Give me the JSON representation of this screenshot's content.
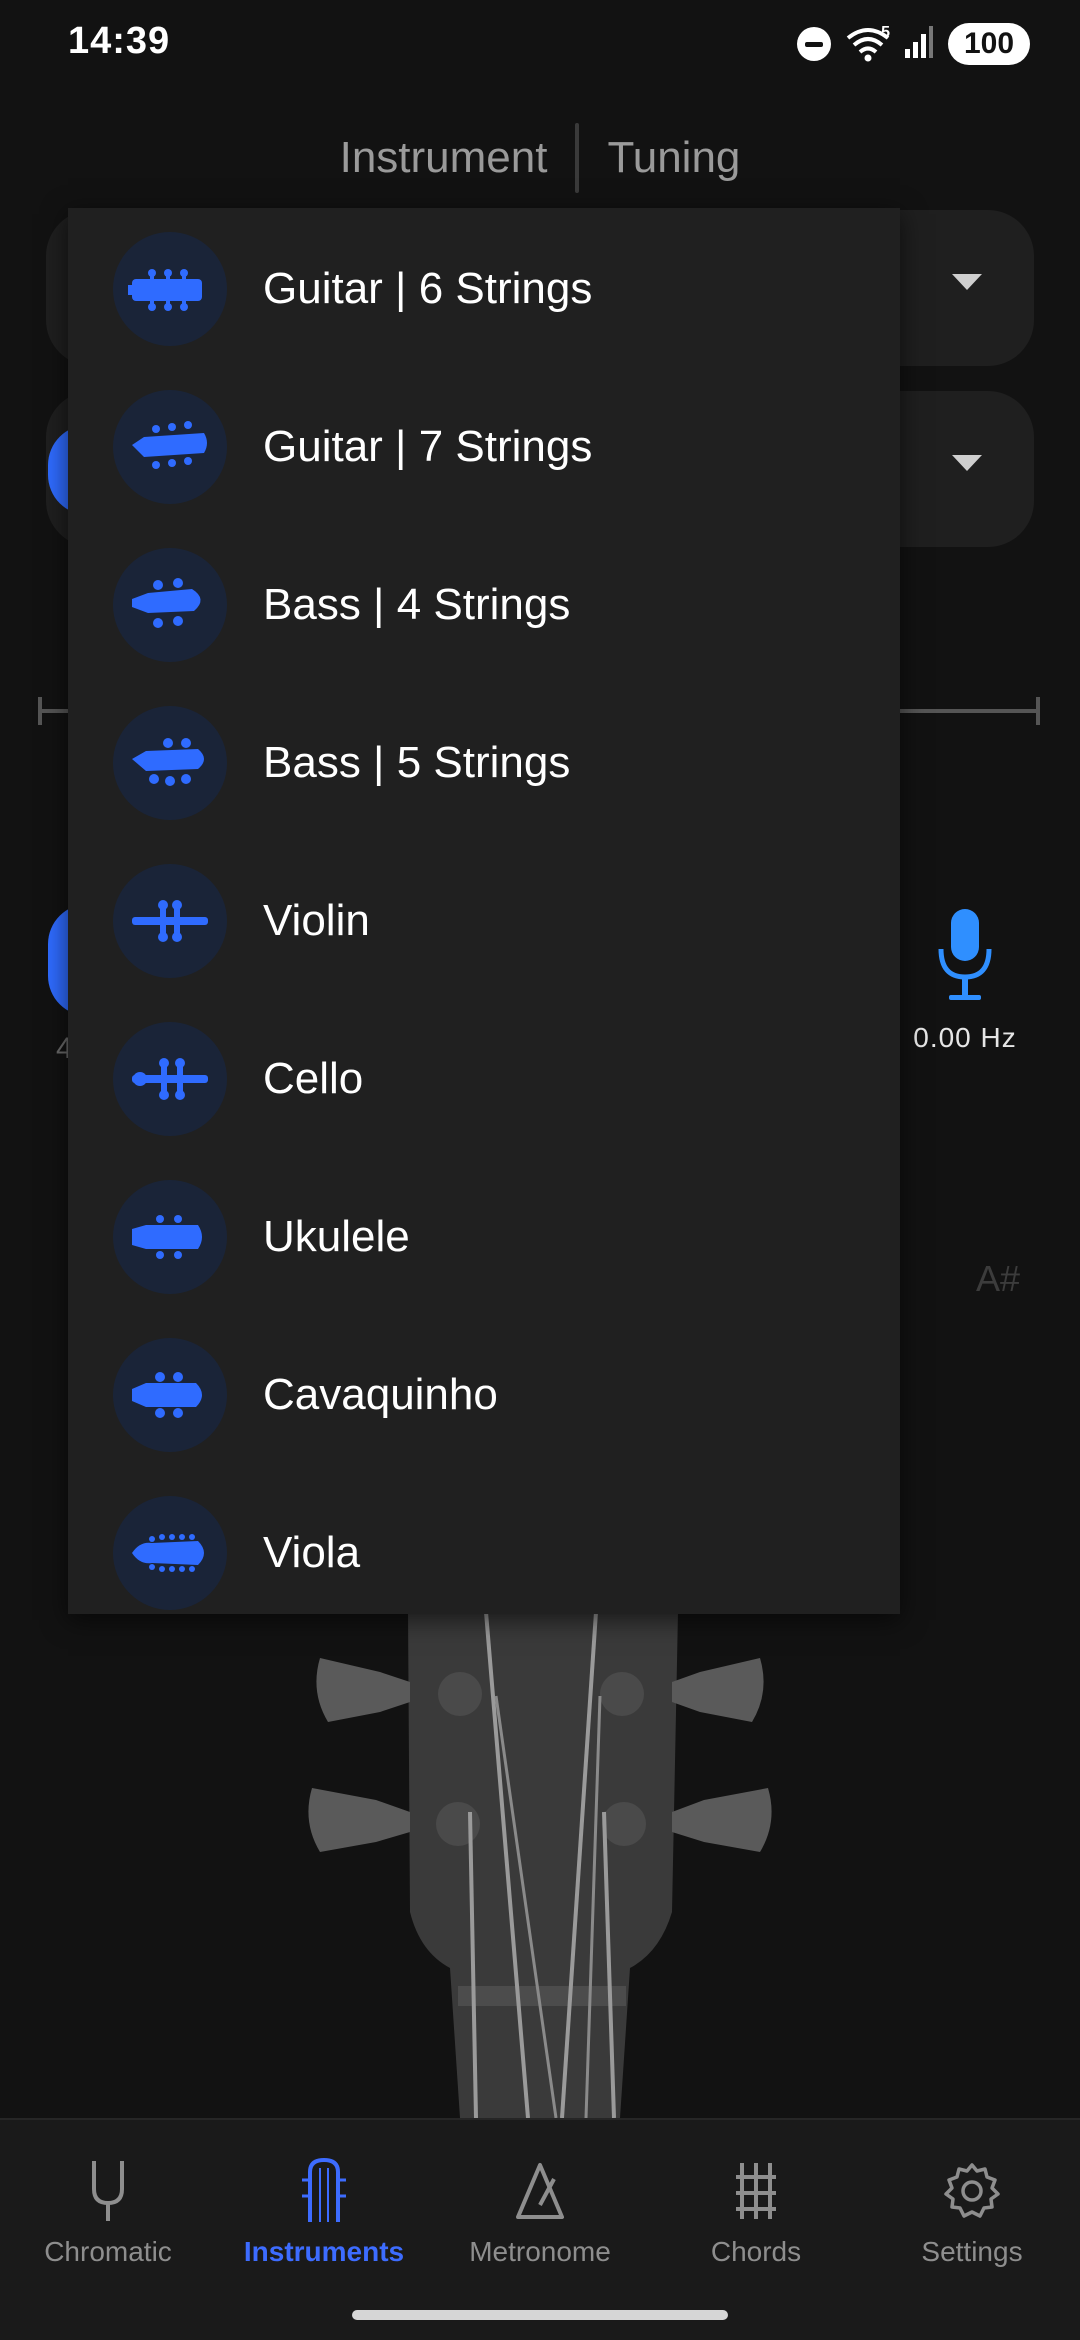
{
  "status_bar": {
    "time": "14:39",
    "wifi_badge": "5",
    "battery": "100"
  },
  "header": {
    "tabs": [
      {
        "label": "Instrument"
      },
      {
        "label": "Tuning"
      }
    ]
  },
  "tuner": {
    "frequency": "0.00 Hz",
    "note_ghost": "A#",
    "partial_text": "4"
  },
  "dropdown": {
    "items": [
      {
        "label": "Guitar | 6 Strings",
        "icon": "guitar-6-headstock-icon"
      },
      {
        "label": "Guitar | 7 Strings",
        "icon": "guitar-7-headstock-icon"
      },
      {
        "label": "Bass | 4 Strings",
        "icon": "bass-4-headstock-icon"
      },
      {
        "label": "Bass | 5 Strings",
        "icon": "bass-5-headstock-icon"
      },
      {
        "label": "Violin",
        "icon": "violin-scroll-icon"
      },
      {
        "label": "Cello",
        "icon": "cello-scroll-icon"
      },
      {
        "label": "Ukulele",
        "icon": "ukulele-headstock-icon"
      },
      {
        "label": "Cavaquinho",
        "icon": "cavaquinho-headstock-icon"
      },
      {
        "label": "Viola",
        "icon": "viola-headstock-icon"
      }
    ]
  },
  "bottom_nav": {
    "items": [
      {
        "label": "Chromatic",
        "icon": "tuning-fork-icon"
      },
      {
        "label": "Instruments",
        "icon": "instrument-headstock-icon"
      },
      {
        "label": "Metronome",
        "icon": "metronome-icon"
      },
      {
        "label": "Chords",
        "icon": "chord-grid-icon"
      },
      {
        "label": "Settings",
        "icon": "gear-icon"
      }
    ],
    "active": "Instruments"
  },
  "colors": {
    "accent": "#3d6cff",
    "icon_blue": "#2f6bff",
    "menu_bg": "#202020",
    "page_bg": "#121212"
  }
}
